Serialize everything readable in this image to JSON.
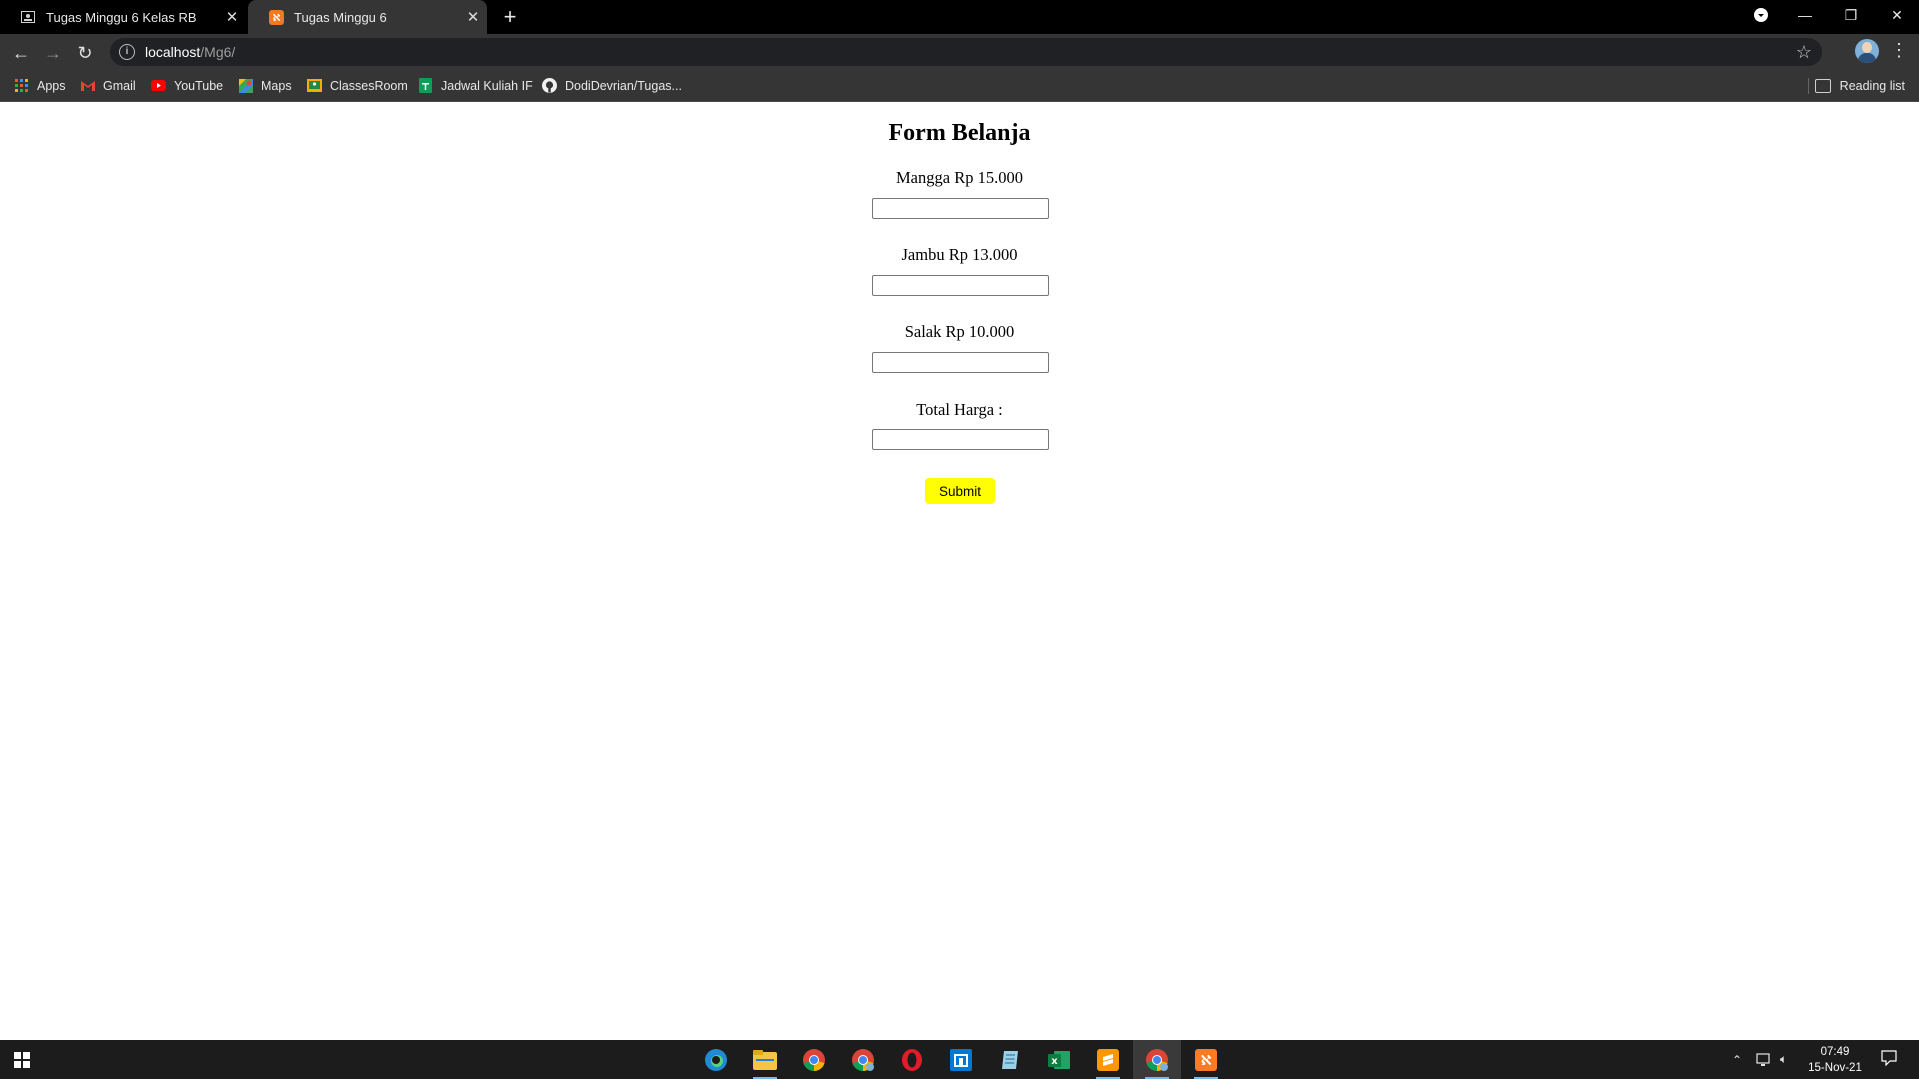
{
  "browser": {
    "tabs": [
      {
        "title": "Tugas Minggu 6 Kelas RB",
        "active": false
      },
      {
        "title": "Tugas Minggu 6",
        "active": true
      }
    ],
    "new_tab": "+",
    "url_host": "localhost",
    "url_path": "/Mg6/",
    "bookmarks": [
      {
        "label": "Apps",
        "icon": "apps-grid-icon"
      },
      {
        "label": "Gmail",
        "icon": "gmail-icon"
      },
      {
        "label": "YouTube",
        "icon": "youtube-icon"
      },
      {
        "label": "Maps",
        "icon": "maps-icon"
      },
      {
        "label": "ClassesRoom",
        "icon": "classroom-icon"
      },
      {
        "label": "Jadwal Kuliah IF",
        "icon": "sheets-icon"
      },
      {
        "label": "DodiDevrian/Tugas...",
        "icon": "github-icon"
      }
    ],
    "reading_list": "Reading list"
  },
  "page": {
    "title": "Form Belanja",
    "fields": [
      {
        "label": "Mangga Rp 15.000",
        "value": ""
      },
      {
        "label": "Jambu Rp 13.000",
        "value": ""
      },
      {
        "label": "Salak Rp 10.000",
        "value": ""
      },
      {
        "label": "Total Harga :",
        "value": ""
      }
    ],
    "submit_label": "Submit",
    "submit_color": "#ffff00"
  },
  "taskbar": {
    "time": "07:49",
    "date": "15-Nov-21",
    "apps": [
      "edge-icon",
      "file-explorer-icon",
      "chrome-icon",
      "chrome-profile-icon",
      "opera-icon",
      "store-icon",
      "notepad-icon",
      "excel-icon",
      "sublime-text-icon",
      "chrome-active-icon",
      "xampp-icon"
    ]
  }
}
